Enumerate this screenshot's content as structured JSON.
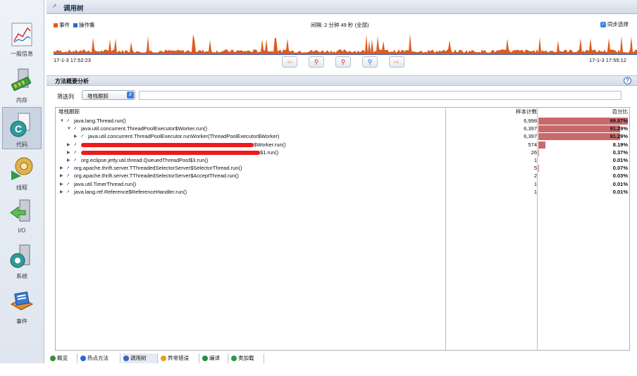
{
  "window": {
    "title": "调用树"
  },
  "sidebar": {
    "items": [
      {
        "label": "一般信息",
        "icon": "chart-icon"
      },
      {
        "label": "内存",
        "icon": "memory-icon"
      },
      {
        "label": "代码",
        "icon": "code-icon",
        "active": true
      },
      {
        "label": "线程",
        "icon": "threads-icon"
      },
      {
        "label": "I/O",
        "icon": "io-icon"
      },
      {
        "label": "系统",
        "icon": "system-icon"
      },
      {
        "label": "事件",
        "icon": "events-icon"
      }
    ]
  },
  "timeline": {
    "legend_events": "事件",
    "legend_ops": "操作集",
    "interval": "间隔: 2 分钟 49 秒 (全部)",
    "sync_label": "同步选择",
    "start_time": "17-1-3 17:52:23",
    "end_time": "17-1-3 17:55:12",
    "colors": {
      "events": "#e05a1a",
      "ops": "#2a6ad0"
    }
  },
  "analysis": {
    "title": "方法概要分析",
    "filter_label": "筛选列",
    "filter_value": "堆栈跟踪",
    "filter_text": ""
  },
  "table": {
    "headers": {
      "stack": "堆栈跟踪",
      "samples": "样本计数",
      "percent": "百分比"
    },
    "rows": [
      {
        "indent": 0,
        "expanded": true,
        "label": "java.lang.Thread.run()",
        "count": "6,998",
        "percent": "99.87%",
        "fraction": 0.9987
      },
      {
        "indent": 1,
        "expanded": true,
        "label": "java.util.concurrent.ThreadPoolExecutor$Worker.run()",
        "count": "6,397",
        "percent": "91.29%",
        "fraction": 0.9129
      },
      {
        "indent": 2,
        "expanded": false,
        "label": "java.util.concurrent.ThreadPoolExecutor.runWorker(ThreadPoolExecutor$Worker)",
        "count": "6,397",
        "percent": "91.29%",
        "fraction": 0.9129
      },
      {
        "indent": 1,
        "expanded": false,
        "label": "$Worker.run()",
        "count": "574",
        "percent": "8.19%",
        "fraction": 0.0819,
        "redacted": true
      },
      {
        "indent": 1,
        "expanded": false,
        "label": "$1.run()",
        "count": "26",
        "percent": "0.37%",
        "fraction": 0.0037,
        "redacted": true
      },
      {
        "indent": 1,
        "expanded": false,
        "label": "org.eclipse.jetty.util.thread.QueuedThreadPool$3.run()",
        "count": "1",
        "percent": "0.01%",
        "fraction": 0.0001
      },
      {
        "indent": 0,
        "expanded": false,
        "label": "org.apache.thrift.server.TThreadedSelectorServer$SelectorThread.run()",
        "count": "5",
        "percent": "0.07%",
        "fraction": 0.0007
      },
      {
        "indent": 0,
        "expanded": false,
        "label": "org.apache.thrift.server.TThreadedSelectorServer$AcceptThread.run()",
        "count": "2",
        "percent": "0.03%",
        "fraction": 0.0003
      },
      {
        "indent": 0,
        "expanded": false,
        "label": "java.util.TimerThread.run()",
        "count": "1",
        "percent": "0.01%",
        "fraction": 0.0001
      },
      {
        "indent": 0,
        "expanded": false,
        "label": "java.lang.ref.Reference$ReferenceHandler.run()",
        "count": "1",
        "percent": "0.01%",
        "fraction": 0.0001
      }
    ]
  },
  "tabs": [
    {
      "label": "概览",
      "icon": "overview-icon",
      "color": "#3a8a3a"
    },
    {
      "label": "热点方法",
      "icon": "hot-methods-icon",
      "color": "#2a6ad0"
    },
    {
      "label": "调用树",
      "icon": "call-tree-icon",
      "color": "#3a68b8",
      "active": true
    },
    {
      "label": "异常错误",
      "icon": "exceptions-icon",
      "color": "#e0a020"
    },
    {
      "label": "编译",
      "icon": "compile-icon",
      "color": "#2a8a4a"
    },
    {
      "label": "类加载",
      "icon": "class-loading-icon",
      "color": "#2a9a4a"
    }
  ]
}
